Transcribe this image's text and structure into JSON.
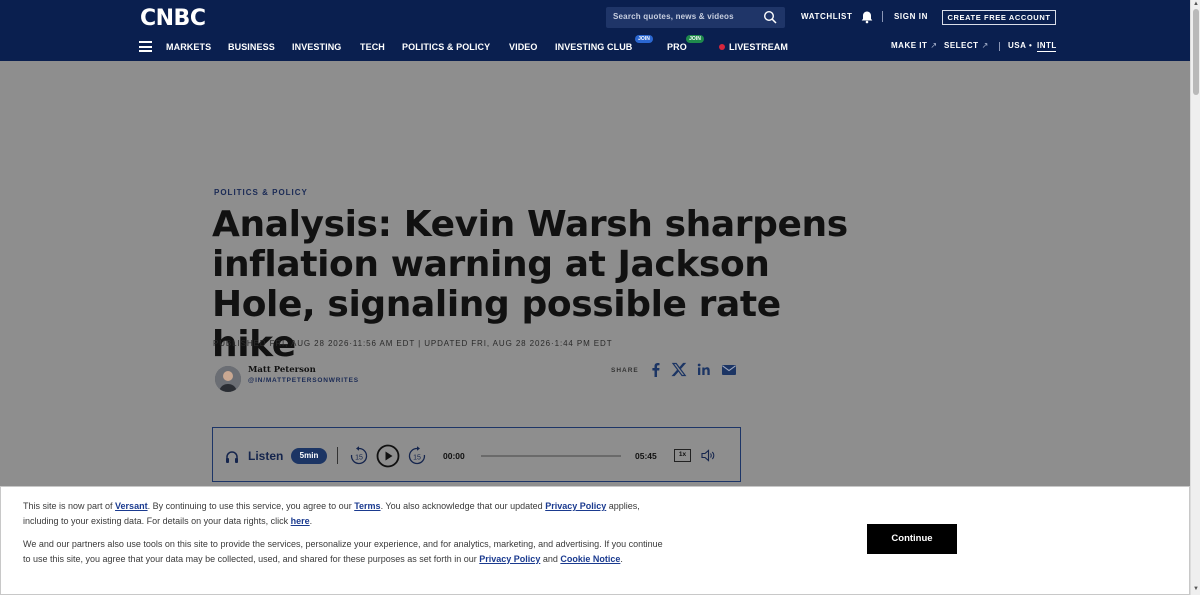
{
  "header": {
    "logo": "CNBC",
    "search_placeholder": "Search quotes, news & videos",
    "watchlist": "WATCHLIST",
    "sign_in": "SIGN IN",
    "create_account": "CREATE FREE ACCOUNT",
    "nav": [
      "MARKETS",
      "BUSINESS",
      "INVESTING",
      "TECH",
      "POLITICS & POLICY",
      "VIDEO",
      "INVESTING CLUB",
      "PRO",
      "LIVESTREAM"
    ],
    "investing_club_badge": "JOIN",
    "pro_badge": "JOIN",
    "make_it": "MAKE IT",
    "select": "SELECT",
    "usa": "USA",
    "dot": "•",
    "intl": "INTL"
  },
  "article": {
    "kicker": "POLITICS & POLICY",
    "headline": "Analysis: Kevin Warsh sharpens inflation warning at Jackson Hole, signaling possible rate hike",
    "dates": "PUBLISHED FRI, AUG 28 2026·11:56 AM EDT | UPDATED FRI, AUG 28 2026·1:44 PM EDT",
    "author": "Matt Peterson",
    "author_handle": "@IN/MATTPETERSONWRITES",
    "share_label": "SHARE"
  },
  "player": {
    "listen": "Listen",
    "duration_pill": "5min",
    "skip_back": "15",
    "skip_forward": "15",
    "elapsed": "00:00",
    "total": "05:45",
    "speed": "1x",
    "progress": 0
  },
  "consent": {
    "p1_a": "This site is now part of ",
    "versant": "Versant",
    "p1_b": ". By continuing to use this service, you agree to our ",
    "terms": "Terms",
    "p1_c": ". You also acknowledge that our updated ",
    "privacy_policy": "Privacy Policy",
    "p1_d": " applies, including to your existing data. For details on your data rights, click ",
    "here": "here",
    "p1_e": ".",
    "p2_a": "We and our partners also use tools on this site to provide the services, personalize your experience, and for analytics, marketing, and advertising. If you continue to use this site, you agree that your data may be collected, used, and shared for these purposes as set forth in our ",
    "privacy_policy_2": "Privacy Policy",
    "p2_b": " and ",
    "cookie_notice": "Cookie Notice",
    "p2_c": ".",
    "continue": "Continue"
  },
  "colors": {
    "header_bg": "#0a1f4f",
    "overlay": "#8e8e8e",
    "live_dot": "#d7263d",
    "badge_blue": "#2b67d1",
    "badge_green": "#1f8a4c"
  },
  "icons": [
    "search-icon",
    "bell-icon",
    "menu-icon",
    "facebook-icon",
    "x-icon",
    "linkedin-icon",
    "email-icon",
    "headphones-icon",
    "rewind-15-icon",
    "play-icon",
    "forward-15-icon",
    "volume-icon"
  ]
}
